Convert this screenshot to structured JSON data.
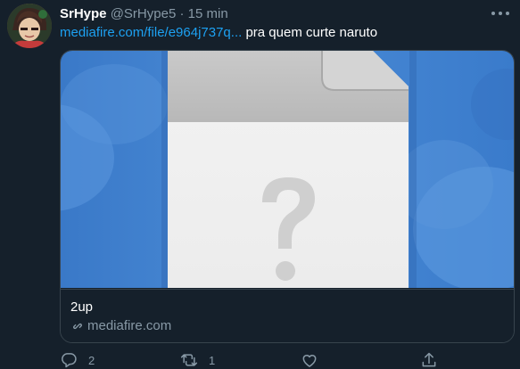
{
  "tweet": {
    "display_name": "SrHype",
    "handle": "@SrHype5",
    "separator": "·",
    "time": "15 min",
    "link_text": "mediafire.com/file/e964j737q...",
    "text": "pra quem curte naruto"
  },
  "card": {
    "title": "2up",
    "domain": "mediafire.com"
  },
  "actions": {
    "reply_count": "2",
    "retweet_count": "1"
  },
  "colors": {
    "background": "#15202b",
    "secondary_text": "#8899a6",
    "link": "#1da1f2",
    "border": "#38444d"
  },
  "icons": [
    "more-icon",
    "link-icon",
    "reply-icon",
    "retweet-icon",
    "like-icon",
    "share-icon",
    "file-question-icon"
  ]
}
